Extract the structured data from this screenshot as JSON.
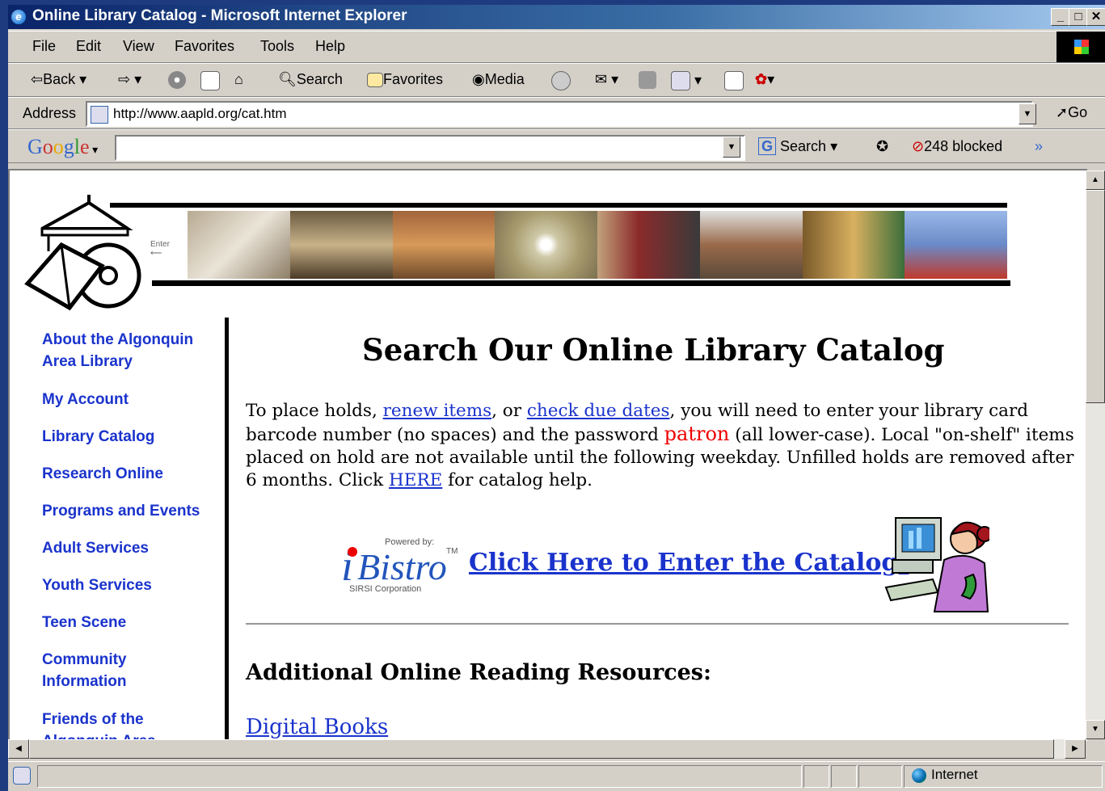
{
  "window": {
    "title": "Online Library Catalog - Microsoft Internet Explorer",
    "controls": [
      "_",
      "□",
      "✕"
    ]
  },
  "menu": [
    "File",
    "Edit",
    "View",
    "Favorites",
    "Tools",
    "Help"
  ],
  "toolbar": {
    "back": "Back",
    "search": "Search",
    "favorites": "Favorites",
    "media": "Media"
  },
  "address": {
    "label": "Address",
    "url": "http://www.aapld.org/cat.htm",
    "go": "Go"
  },
  "google_bar": {
    "logo": "Google",
    "search": "Search",
    "blocked": "248 blocked",
    "more": "»"
  },
  "nav": [
    "About the Algonquin Area Library",
    "My Account",
    "Library Catalog",
    "Research Online",
    "Programs and Events",
    "Adult Services",
    "Youth Services",
    "Teen Scene",
    "Community Information",
    "Friends of the Algonquin Area"
  ],
  "banner": {
    "enter_label": "Enter"
  },
  "main": {
    "heading": "Search Our Online Library Catalog",
    "para_1": "To place holds, ",
    "link_renew": "renew items",
    "para_2": ", or ",
    "link_due": "check due dates",
    "para_3": ", you will need to enter your library card barcode number (no spaces) and the password ",
    "password": "patron",
    "para_4": " (all lower-case).  Local \"on-shelf\" items placed on hold are not available until the following weekday. Unfilled holds are removed after 6 months. Click ",
    "link_here": "HERE",
    "para_5": " for catalog help.",
    "ibistro": {
      "powered_by": "Powered by:",
      "i": "i",
      "bistro": "Bistro",
      "tm": "TM",
      "corp": "SIRSI Corporation"
    },
    "enter_catalog": "Click Here to Enter the Catalog!",
    "additional_heading": "Additional Online Reading Resources:",
    "digital_books": "Digital Books"
  },
  "status": {
    "zone": "Internet"
  },
  "colors": {
    "link": "#1a33cc",
    "password": "#ee0000",
    "titlebar": "#0a246a"
  }
}
